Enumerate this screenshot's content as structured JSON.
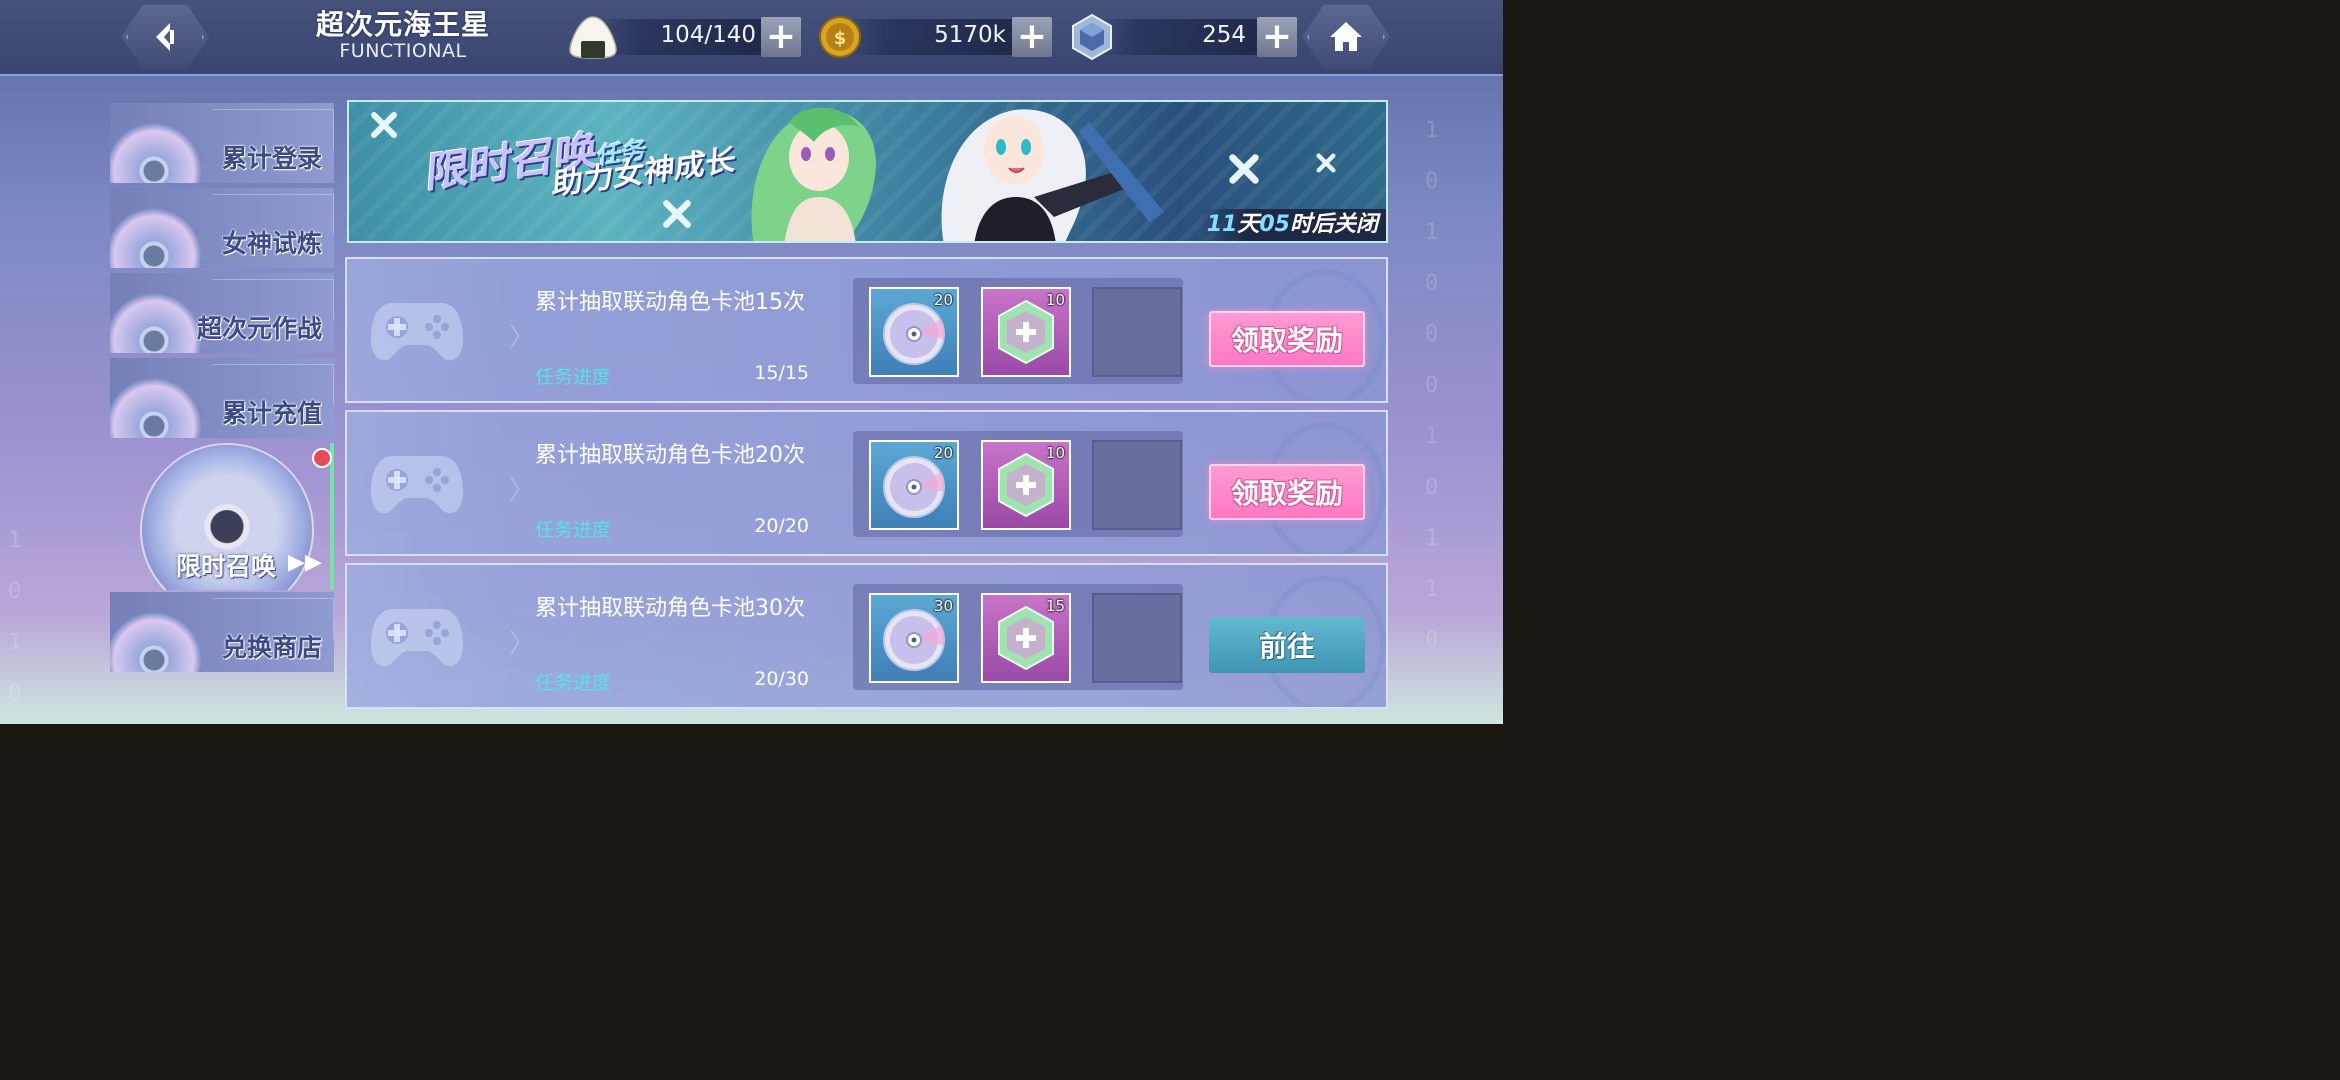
{
  "header": {
    "title_main": "超次元海王星",
    "title_sub": "FUNCTIONAL",
    "stamina": "104/140",
    "coins": "5170k",
    "gems": "254",
    "icons": {
      "back": "back-arrow-icon",
      "stamina": "onigiri-icon",
      "coin": "coin-icon",
      "gem": "crystal-icon",
      "home": "home-icon",
      "plus": "plus-icon"
    }
  },
  "sidebar": {
    "items": [
      {
        "label": "累计登录"
      },
      {
        "label": "女神试炼"
      },
      {
        "label": "超次元作战"
      },
      {
        "label": "累计充值"
      },
      {
        "label": "限时召唤",
        "active": true
      },
      {
        "label": "兑换商店"
      }
    ]
  },
  "banner": {
    "line1_a": "限时召唤",
    "line1_b": "任务",
    "line2": "助力女神成长",
    "countdown_days": "11",
    "countdown_day_unit": "天",
    "countdown_hours": "05",
    "countdown_suffix": "时后关闭"
  },
  "tasks": [
    {
      "name": "累计抽取联动角色卡池15次",
      "progress_label": "任务进度",
      "progress": "15/15",
      "rewards": [
        {
          "icon": "disc-icon",
          "count": "20"
        },
        {
          "icon": "crystal-shard-icon",
          "count": "10"
        }
      ],
      "button": "领取奖励"
    },
    {
      "name": "累计抽取联动角色卡池20次",
      "progress_label": "任务进度",
      "progress": "20/20",
      "rewards": [
        {
          "icon": "disc-icon",
          "count": "20"
        },
        {
          "icon": "crystal-shard-icon",
          "count": "10"
        }
      ],
      "button": "领取奖励"
    },
    {
      "name": "累计抽取联动角色卡池30次",
      "progress_label": "任务进度",
      "progress": "20/30",
      "rewards": [
        {
          "icon": "disc-icon",
          "count": "30"
        },
        {
          "icon": "crystal-shard-icon",
          "count": "15"
        }
      ],
      "button": "前往"
    }
  ],
  "colors": {
    "accent_cyan": "#58e1e6",
    "claim_pink": "#ff77c1",
    "goto_teal": "#3e95b3",
    "notify_red": "#e64a5a"
  }
}
